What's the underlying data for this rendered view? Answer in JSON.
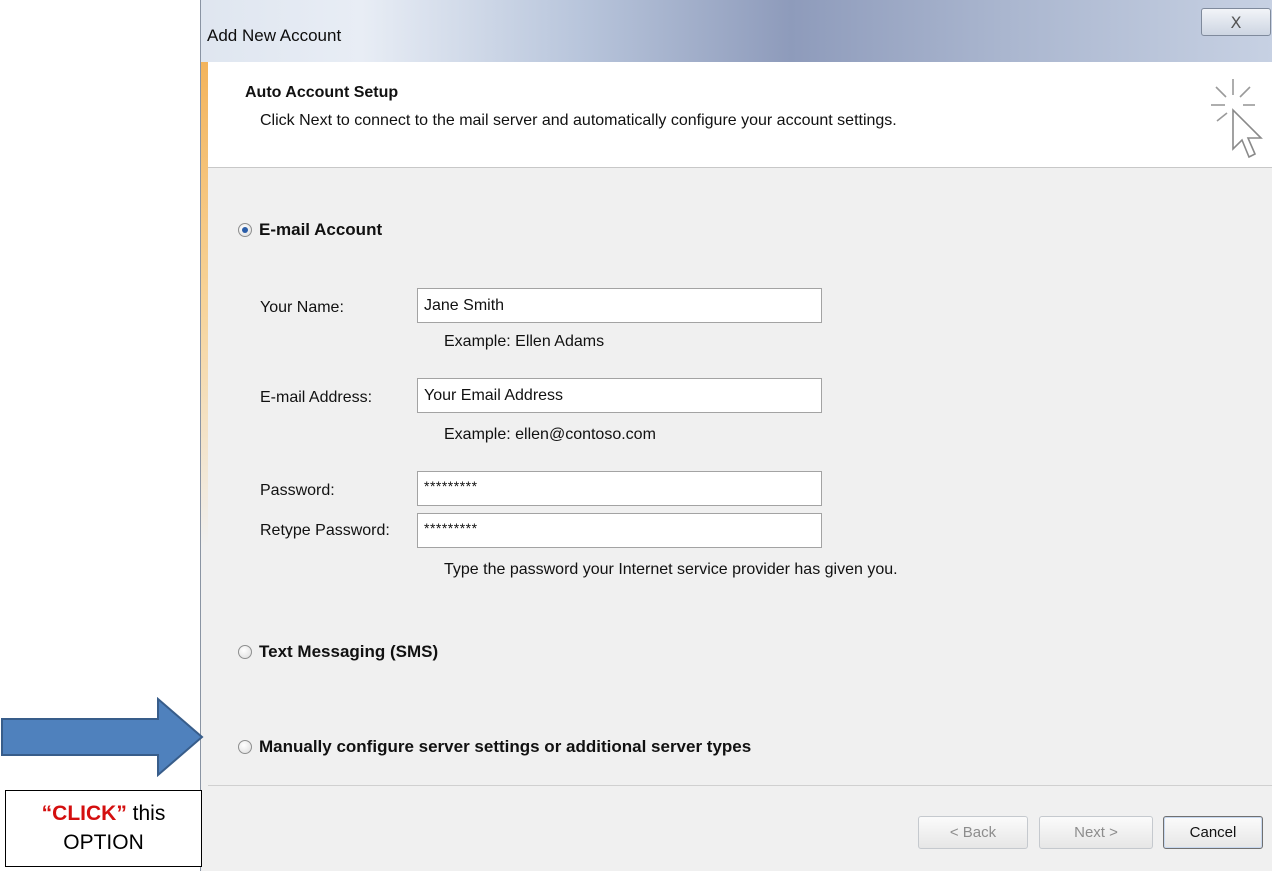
{
  "dialog": {
    "title": "Add New Account",
    "close_glyph": "X",
    "header": {
      "title": "Auto Account Setup",
      "subtitle": "Click Next to connect to the mail server and automatically configure your account settings."
    },
    "options": {
      "email": {
        "label": "E-mail Account",
        "selected": true
      },
      "sms": {
        "label": "Text Messaging (SMS)",
        "selected": false
      },
      "manual": {
        "label": "Manually configure server settings or additional server types",
        "selected": false
      }
    },
    "fields": {
      "name": {
        "label": "Your Name:",
        "value": "Jane Smith",
        "example": "Example: Ellen Adams"
      },
      "email": {
        "label": "E-mail Address:",
        "value": "Your Email Address",
        "example": "Example: ellen@contoso.com"
      },
      "password": {
        "label": "Password:",
        "value": "*********"
      },
      "retype": {
        "label": "Retype Password:",
        "value": "*********"
      },
      "password_hint": "Type the password your Internet service provider has given you."
    },
    "buttons": {
      "back": "< Back",
      "next": "Next >",
      "cancel": "Cancel"
    }
  },
  "annotation": {
    "emphasis": "“CLICK”",
    "text1": " this",
    "text2": "OPTION",
    "arrow_color": "#4f81bd"
  }
}
